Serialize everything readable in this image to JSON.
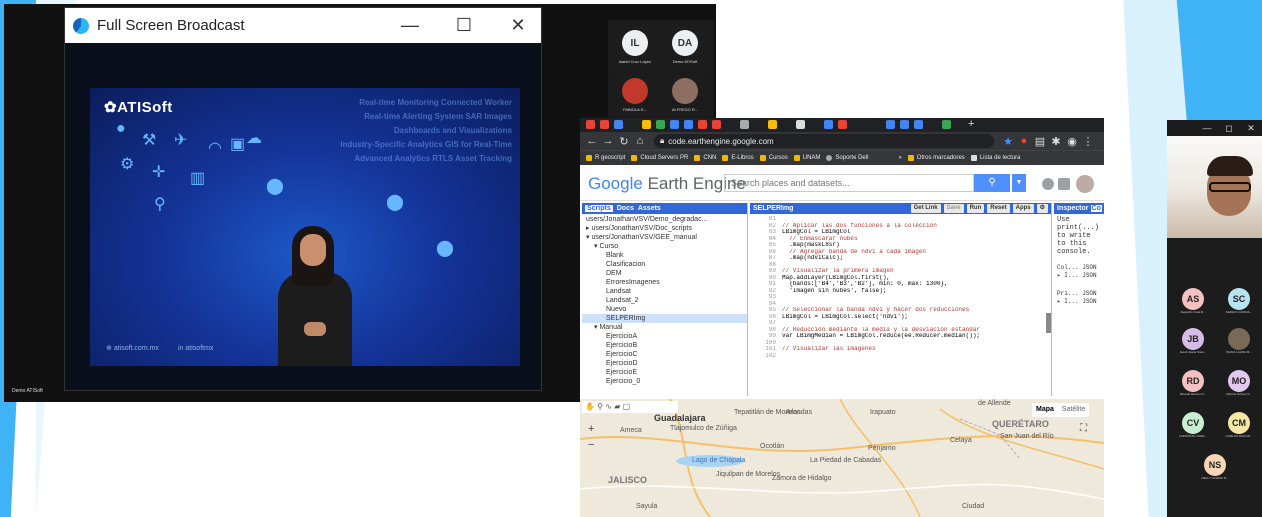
{
  "zoom_left": {
    "bottom_label": "Demo ATISoft"
  },
  "broadcast_window": {
    "title": "Full Screen Broadcast",
    "controls": {
      "minimize": "—",
      "maximize": "☐",
      "close": "✕"
    },
    "slide": {
      "brand": "ATISoft",
      "feature_lines": [
        "Real-time Monitoring   Connected Worker",
        "Real-time Alerting System    SAR Images",
        "Dashboards and Visualizations",
        "Industry-Specific Analytics   GIS for Real-Time",
        "Advanced Analytics    RTLS Asset Tracking"
      ],
      "website": "atisoft.com.mx",
      "social": "atisoftmx"
    }
  },
  "participants_top": [
    {
      "initials": "IL",
      "name": "Isabel Cruz López",
      "color": "#eceff1"
    },
    {
      "initials": "DA",
      "name": "Demo ATISoft",
      "color": "#eceff1"
    },
    {
      "initials": "",
      "name": "FABIOLA D...",
      "color": "#c0392b"
    },
    {
      "initials": "",
      "name": "ALFREDO R...",
      "color": "#8d6e63"
    }
  ],
  "browser": {
    "url": "code.earthengine.google.com",
    "bookmarks": [
      "R geoscript",
      "Cloud Servers PR",
      "CNN",
      "E-Libros",
      "Cursos",
      "UNAM",
      "Soporte Dell"
    ],
    "bookmarks_right": [
      "Otros marcadores",
      "Lista de lectura"
    ]
  },
  "gee": {
    "logo_google": "Google",
    "logo_rest": "Earth Engine",
    "search_placeholder": "Search places and datasets...",
    "left_tabs": [
      "Scripts",
      "Docs",
      "Assets"
    ],
    "tree": [
      {
        "text": "users/JonathanVSV/Demo_degradac...",
        "indent": 4,
        "sel": false
      },
      {
        "text": "▸ users/JonathanVSV/Doc_scripts",
        "indent": 4,
        "sel": false
      },
      {
        "text": "▾ users/JonathanVSV/GEE_manual",
        "indent": 4,
        "sel": false
      },
      {
        "text": "▾ Curso",
        "indent": 12,
        "sel": false
      },
      {
        "text": "Blank",
        "indent": 24,
        "sel": false
      },
      {
        "text": "Clasificacion",
        "indent": 24,
        "sel": false
      },
      {
        "text": "DEM",
        "indent": 24,
        "sel": false
      },
      {
        "text": "ErroresImagenes",
        "indent": 24,
        "sel": false
      },
      {
        "text": "Landsat",
        "indent": 24,
        "sel": false
      },
      {
        "text": "Landsat_2",
        "indent": 24,
        "sel": false
      },
      {
        "text": "Nuevo",
        "indent": 24,
        "sel": false
      },
      {
        "text": "SELPERImg",
        "indent": 24,
        "sel": true
      },
      {
        "text": "▾ Manual",
        "indent": 12,
        "sel": false
      },
      {
        "text": "EjercicioA",
        "indent": 24,
        "sel": false
      },
      {
        "text": "EjercicioB",
        "indent": 24,
        "sel": false
      },
      {
        "text": "EjercicioC",
        "indent": 24,
        "sel": false
      },
      {
        "text": "EjercicioD",
        "indent": 24,
        "sel": false
      },
      {
        "text": "EjercicioE",
        "indent": 24,
        "sel": false
      },
      {
        "text": "Ejercicio_0",
        "indent": 24,
        "sel": false
      }
    ],
    "script_name": "SELPERImg",
    "toolbar": [
      "Get Link",
      "Save",
      "Run",
      "Reset",
      "Apps"
    ],
    "code": [
      {
        "n": "81",
        "t": ""
      },
      {
        "n": "82",
        "t": "// Aplicar las dos funciones a la colección",
        "c": "com"
      },
      {
        "n": "83",
        "t": "LBimgCol = LBimgCol"
      },
      {
        "n": "84",
        "t": "  // Enmascarar nubes",
        "c": "com"
      },
      {
        "n": "85",
        "t": "  .map(maskL8sr)"
      },
      {
        "n": "86",
        "t": "  // Agregar banda de ndvi a cada imagen",
        "c": "com"
      },
      {
        "n": "87",
        "t": "  .map(ndviCalc);"
      },
      {
        "n": "88",
        "t": ""
      },
      {
        "n": "89",
        "t": "// Visualizar la primera imagen",
        "c": "com"
      },
      {
        "n": "90",
        "t": "Map.addLayer(LBimgCol.first(),"
      },
      {
        "n": "91",
        "t": "  {bands:['B4','B3','B2'], min: 0, max: 1300},"
      },
      {
        "n": "92",
        "t": "  'Imagen sin nubes', false);"
      },
      {
        "n": "93",
        "t": ""
      },
      {
        "n": "94",
        "t": ""
      },
      {
        "n": "95",
        "t": "// Seleccionar la banda ndvi y hacer dos reducciones",
        "c": "com"
      },
      {
        "n": "96",
        "t": "LBimgCol = LBimgCol.select('ndvi');"
      },
      {
        "n": "97",
        "t": ""
      },
      {
        "n": "98",
        "t": "// Reducción mediante la media y la desviación estándar",
        "c": "com"
      },
      {
        "n": "99",
        "t": "var LBimgMedian = LBimgCol.reduce(ee.Reducer.median());"
      },
      {
        "n": "100",
        "t": ""
      },
      {
        "n": "101",
        "t": "// Visualizar las imágenes",
        "c": "com"
      },
      {
        "n": "102",
        "t": ""
      }
    ],
    "right_tabs": [
      "Inspector",
      "Co"
    ],
    "console_text": [
      "Use",
      "print(...)",
      "to write",
      "to this",
      "console."
    ],
    "console_items": [
      "Col... JSON",
      "▸ I...  JSON",
      "Pri... JSON",
      "▸ I...  JSON"
    ],
    "map": {
      "type_buttons": [
        "Mapa",
        "Satélite"
      ],
      "labels": [
        {
          "t": "Guadalajara",
          "big": true
        },
        {
          "t": "Tepatitlán de Morelos"
        },
        {
          "t": "Arandas"
        },
        {
          "t": "Irapuato"
        },
        {
          "t": "Celaya"
        },
        {
          "t": "QUERÉTARO",
          "big": true
        },
        {
          "t": "San Juan del Río"
        },
        {
          "t": "Tlajomulco de Zúñiga"
        },
        {
          "t": "Ameca"
        },
        {
          "t": "Ocotlán"
        },
        {
          "t": "Lago de Chapala"
        },
        {
          "t": "La Piedad de Cabadas"
        },
        {
          "t": "Pénjamo"
        },
        {
          "t": "JALISCO",
          "big": true
        },
        {
          "t": "Jiquilpan de Morelos"
        },
        {
          "t": "Zamora de Hidalgo"
        },
        {
          "t": "Sayula"
        },
        {
          "t": "Ciudad"
        },
        {
          "t": "de Allende"
        }
      ]
    }
  },
  "right_participants": [
    {
      "initials": "AS",
      "name": "Alejandro Fuiel R...",
      "color": "#f3c1c1"
    },
    {
      "initials": "SC",
      "name": "SERGIO GARCIA...",
      "color": "#b9e3ef"
    },
    {
      "initials": "JB",
      "name": "Jacob Jesús Nieto...",
      "color": "#d6bde8"
    },
    {
      "initials": "",
      "name": "DIANA LAURA M...",
      "color": "#7a6a55"
    },
    {
      "initials": "RD",
      "name": "Ricardo Ramon D...",
      "color": "#f3c1c1"
    },
    {
      "initials": "MO",
      "name": "Mónica Ochoa (Y...",
      "color": "#e3c7ef"
    },
    {
      "initials": "CV",
      "name": "CHRISTIAN JAVIE...",
      "color": "#c8efd2"
    },
    {
      "initials": "CM",
      "name": "CARLOS DIAZ MI...",
      "color": "#f5e7a6"
    },
    {
      "initials": "NS",
      "name": "NELLY LILIANO R...",
      "color": "#f8d6b5"
    }
  ],
  "cam_window": {
    "minimize": "—",
    "maximize": "◻",
    "close": "✕"
  }
}
